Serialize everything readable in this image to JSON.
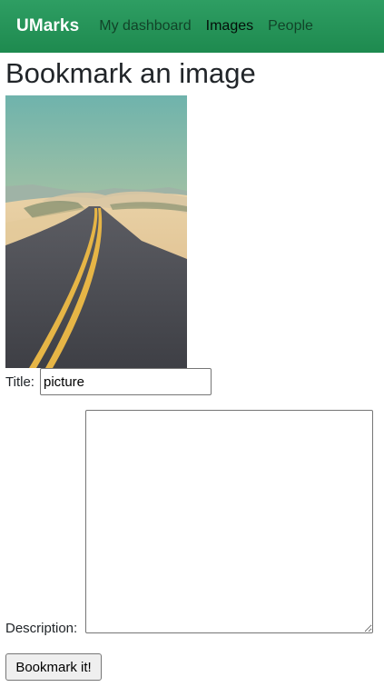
{
  "navbar": {
    "brand": "UMarks",
    "links": [
      {
        "label": "My dashboard",
        "active": false
      },
      {
        "label": "Images",
        "active": true
      },
      {
        "label": "People",
        "active": false
      }
    ],
    "colors": {
      "background": "#2e9e63",
      "brand": "#ffffff"
    }
  },
  "page": {
    "title": "Bookmark an image"
  },
  "form": {
    "title_label": "Title:",
    "title_value": "picture",
    "description_label": "Description:",
    "description_value": "",
    "submit_label": "Bookmark it!"
  }
}
